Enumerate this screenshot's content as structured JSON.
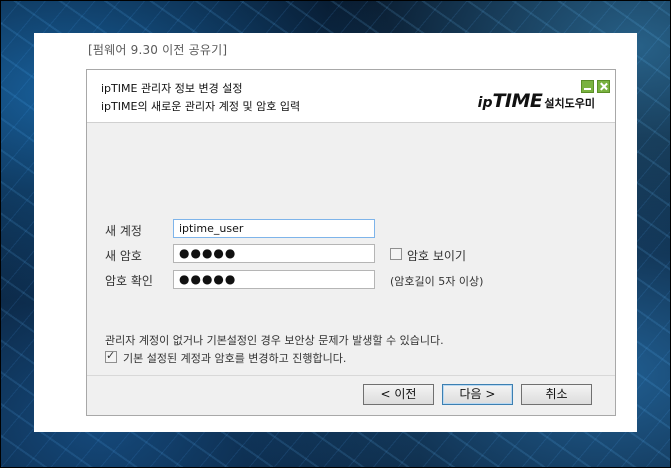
{
  "caption": "[펌웨어 9.30 이전 공유기]",
  "header": {
    "title": "ipTIME 관리자 정보 변경 설정",
    "subtitle": "ipTIME의 새로운 관리자 계정 및 암호 입력",
    "logo_ip": "ip",
    "logo_time": "TIME",
    "logo_suffix": "설치도우미"
  },
  "form": {
    "account_label": "새 계정",
    "account_value": "iptime_user",
    "password_label": "새 암호",
    "password_value": "●●●●●",
    "confirm_label": "암호 확인",
    "confirm_value": "●●●●●",
    "show_password_label": "암호 보이기",
    "show_password_checked": false,
    "length_hint": "(암호길이 5자 이상)"
  },
  "notice": {
    "warning": "관리자 계정이 없거나 기본설정인 경우 보안상 문제가 발생할 수 있습니다.",
    "proceed_label": "기본 설정된 계정과 암호를 변경하고 진행합니다.",
    "proceed_checked": true
  },
  "buttons": {
    "prev": "< 이전",
    "next": "다음 >",
    "cancel": "취소"
  },
  "colors": {
    "window_button": "#79b23f",
    "focus_border": "#7eb4ea",
    "default_button_border": "#3c7fb1"
  }
}
